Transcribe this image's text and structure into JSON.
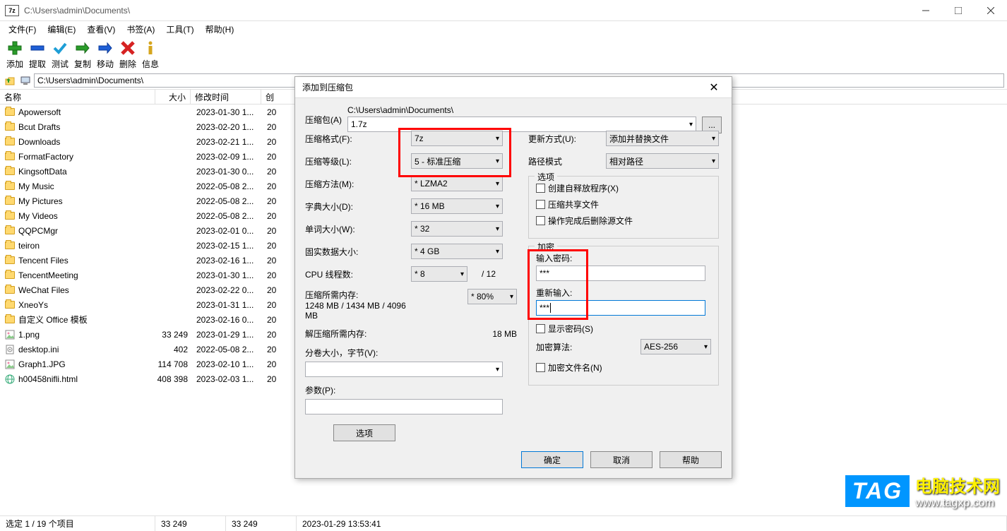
{
  "window": {
    "title": "C:\\Users\\admin\\Documents\\",
    "app_icon_text": "7z"
  },
  "menu": {
    "file": "文件(F)",
    "edit": "编辑(E)",
    "view": "查看(V)",
    "bookmarks": "书签(A)",
    "tools": "工具(T)",
    "help": "帮助(H)"
  },
  "toolbar": {
    "add": "添加",
    "extract": "提取",
    "test": "测试",
    "copy": "复制",
    "move": "移动",
    "delete": "删除",
    "info": "信息"
  },
  "address_path": "C:\\Users\\admin\\Documents\\",
  "columns": {
    "name": "名称",
    "size": "大小",
    "modified": "修改时间",
    "created": "创"
  },
  "files": [
    {
      "icon": "folder",
      "name": "Apowersoft",
      "size": "",
      "date": "2023-01-30 1...",
      "created": "20"
    },
    {
      "icon": "folder",
      "name": "Bcut Drafts",
      "size": "",
      "date": "2023-02-20 1...",
      "created": "20"
    },
    {
      "icon": "folder",
      "name": "Downloads",
      "size": "",
      "date": "2023-02-21 1...",
      "created": "20"
    },
    {
      "icon": "folder",
      "name": "FormatFactory",
      "size": "",
      "date": "2023-02-09 1...",
      "created": "20"
    },
    {
      "icon": "folder",
      "name": "KingsoftData",
      "size": "",
      "date": "2023-01-30 0...",
      "created": "20"
    },
    {
      "icon": "folder",
      "name": "My Music",
      "size": "",
      "date": "2022-05-08 2...",
      "created": "20"
    },
    {
      "icon": "folder",
      "name": "My Pictures",
      "size": "",
      "date": "2022-05-08 2...",
      "created": "20"
    },
    {
      "icon": "folder",
      "name": "My Videos",
      "size": "",
      "date": "2022-05-08 2...",
      "created": "20"
    },
    {
      "icon": "folder",
      "name": "QQPCMgr",
      "size": "",
      "date": "2023-02-01 0...",
      "created": "20"
    },
    {
      "icon": "folder",
      "name": "teiron",
      "size": "",
      "date": "2023-02-15 1...",
      "created": "20"
    },
    {
      "icon": "folder",
      "name": "Tencent Files",
      "size": "",
      "date": "2023-02-16 1...",
      "created": "20"
    },
    {
      "icon": "folder",
      "name": "TencentMeeting",
      "size": "",
      "date": "2023-01-30 1...",
      "created": "20"
    },
    {
      "icon": "folder",
      "name": "WeChat Files",
      "size": "",
      "date": "2023-02-22 0...",
      "created": "20"
    },
    {
      "icon": "folder",
      "name": "XneoYs",
      "size": "",
      "date": "2023-01-31 1...",
      "created": "20"
    },
    {
      "icon": "folder",
      "name": "自定义 Office 模板",
      "size": "",
      "date": "2023-02-16 0...",
      "created": "20"
    },
    {
      "icon": "image",
      "name": "1.png",
      "size": "33 249",
      "date": "2023-01-29 1...",
      "created": "20"
    },
    {
      "icon": "ini",
      "name": "desktop.ini",
      "size": "402",
      "date": "2022-05-08 2...",
      "created": "20"
    },
    {
      "icon": "image",
      "name": "Graph1.JPG",
      "size": "114 708",
      "date": "2023-02-10 1...",
      "created": "20"
    },
    {
      "icon": "html",
      "name": "h00458nifli.html",
      "size": "408 398",
      "date": "2023-02-03 1...",
      "created": "20"
    }
  ],
  "status": {
    "selection": "选定 1 / 19 个项目",
    "size1": "33 249",
    "size2": "33 249",
    "datetime": "2023-01-29 13:53:41"
  },
  "dialog": {
    "title": "添加到压缩包",
    "archive_label": "压缩包(A)",
    "archive_path": "C:\\Users\\admin\\Documents\\",
    "archive_name": "1.7z",
    "browse_btn": "...",
    "format_label": "压缩格式(F):",
    "format_value": "7z",
    "level_label": "压缩等级(L):",
    "level_value": "5 - 标准压缩",
    "method_label": "压缩方法(M):",
    "method_value": "* LZMA2",
    "dict_label": "字典大小(D):",
    "dict_value": "* 16 MB",
    "word_label": "单词大小(W):",
    "word_value": "* 32",
    "solid_label": "固实数据大小:",
    "solid_value": "* 4 GB",
    "threads_label": "CPU 线程数:",
    "threads_value": "* 8",
    "threads_max": "/ 12",
    "mem_compress_label": "压缩所需内存:",
    "mem_compress_value": "1248 MB / 1434 MB / 4096 MB",
    "mem_pct": "* 80%",
    "mem_decompress_label": "解压缩所需内存:",
    "mem_decompress_value": "18 MB",
    "split_label": "分卷大小，字节(V):",
    "params_label": "参数(P):",
    "options_btn": "选项",
    "update_label": "更新方式(U):",
    "update_value": "添加并替换文件",
    "pathmode_label": "路径模式",
    "pathmode_value": "相对路径",
    "options_legend": "选项",
    "sfx_label": "创建自释放程序(X)",
    "shared_label": "压缩共享文件",
    "delete_after_label": "操作完成后删除源文件",
    "encrypt_legend": "加密",
    "pwd_label": "输入密码:",
    "pwd_value": "***",
    "pwd2_label": "重新输入:",
    "pwd2_value": "***",
    "show_pwd_label": "显示密码(S)",
    "enc_method_label": "加密算法:",
    "enc_method_value": "AES-256",
    "enc_names_label": "加密文件名(N)",
    "ok": "确定",
    "cancel": "取消",
    "help": "帮助"
  },
  "watermark": {
    "tag": "TAG",
    "line1": "电脑技术网",
    "line2": "www.tagxp.com"
  }
}
